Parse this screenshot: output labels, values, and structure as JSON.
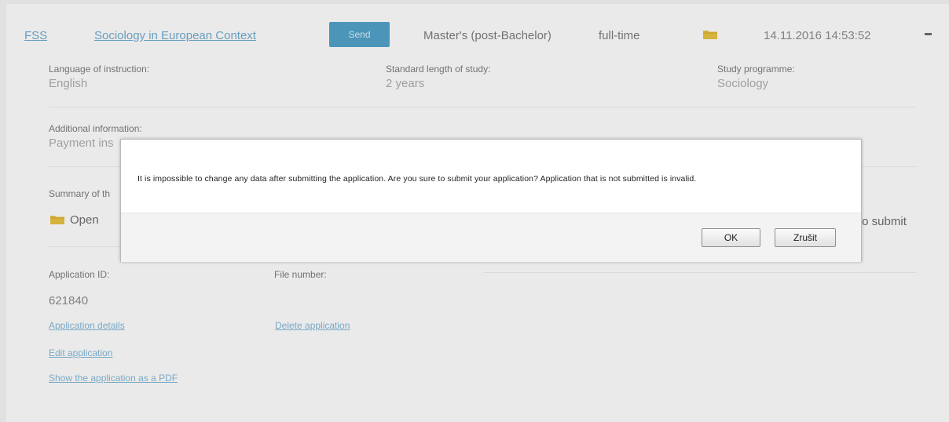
{
  "header": {
    "faculty": "FSS",
    "programme_name": "Sociology in European Context",
    "send_label": "Send",
    "degree": "Master's (post-Bachelor)",
    "attendance": "full-time",
    "timestamp": "14.11.2016 14:53:52"
  },
  "details": {
    "language_label": "Language of instruction:",
    "language_value": "English",
    "length_label": "Standard length of study:",
    "length_value": "2 years",
    "study_prog_label": "Study programme:",
    "study_prog_value": "Sociology",
    "additional_label": "Additional information:",
    "additional_value": "Payment ins",
    "summary_label": "Summary of th",
    "open_label": "Open",
    "to_submit_text": "to submit",
    "app_id_label": "Application ID:",
    "app_id_value": "621840",
    "file_number_label": "File number:",
    "links": {
      "app_details": "Application details",
      "delete_app": "Delete application",
      "edit_app": "Edit application",
      "show_pdf": "Show the application as a PDF"
    }
  },
  "dialog": {
    "message": "It is impossible to change any data after submitting the application. Are you sure to submit your application? Application that is not submitted is invalid.",
    "ok_label": "OK",
    "cancel_label": "Zrušit"
  },
  "colors": {
    "accent": "#4a9fc8",
    "link": "#6aa9cf",
    "folder": "#e8c13a"
  }
}
